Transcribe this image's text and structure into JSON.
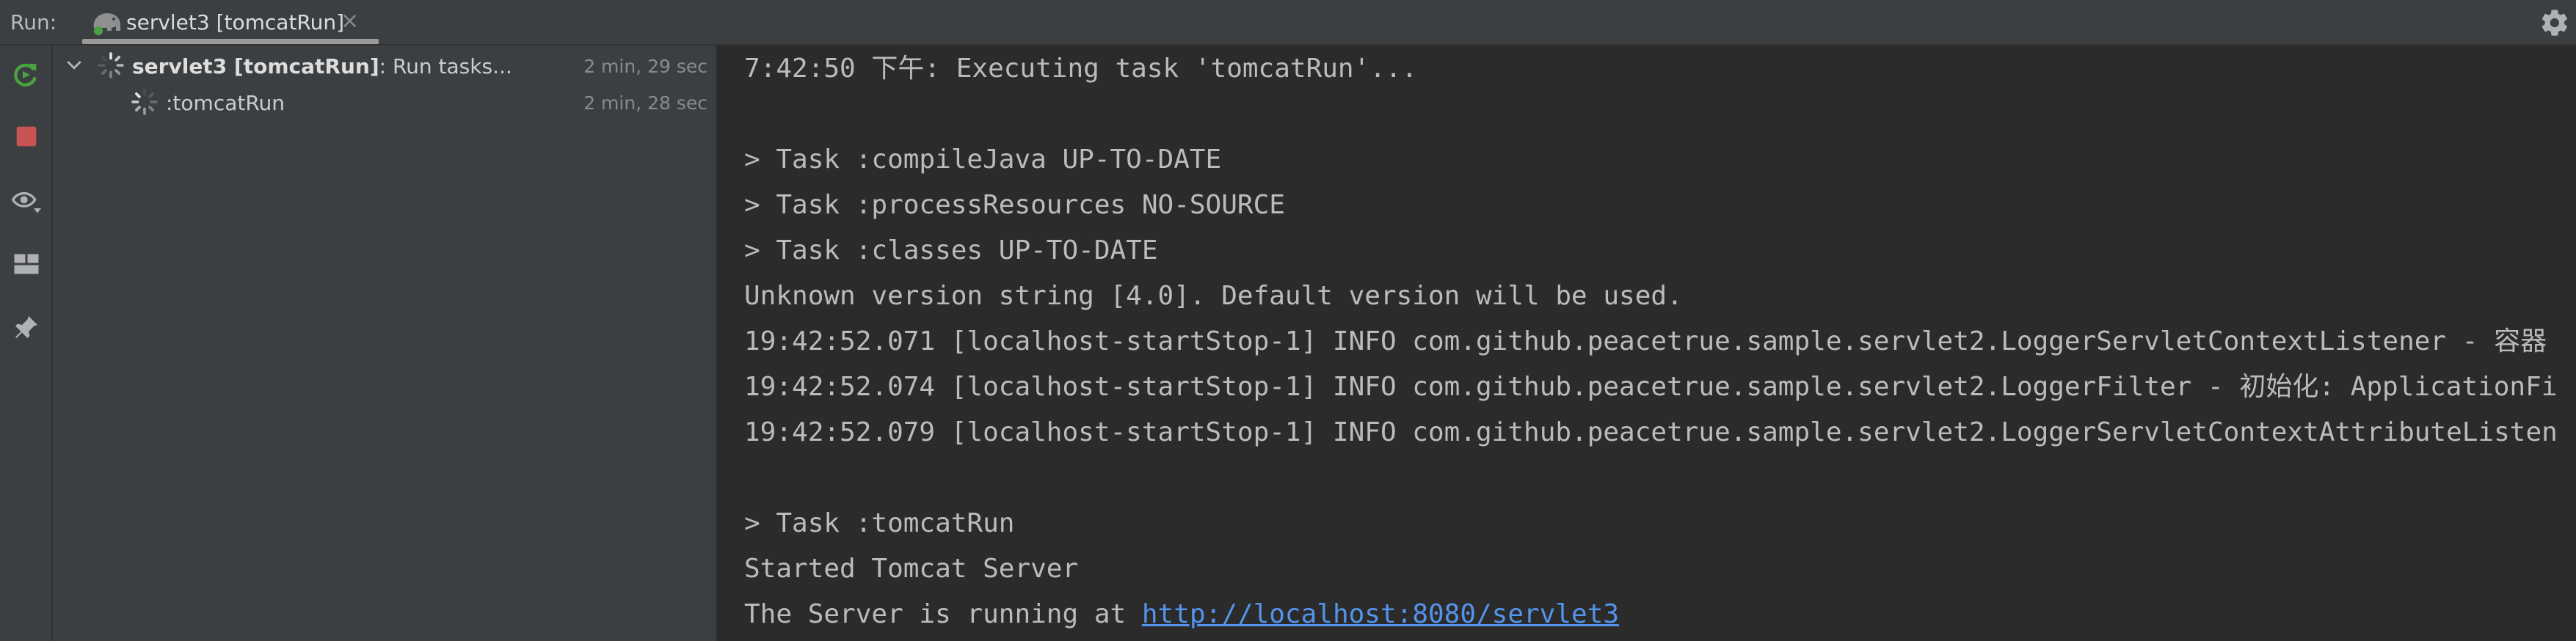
{
  "run_bar": {
    "label": "Run:",
    "tab": {
      "label": "servlet3 [tomcatRun]",
      "close": "×"
    }
  },
  "toolbar": {
    "buttons": [
      "rerun-icon",
      "stop-icon",
      "eye-icon",
      "layout-icon",
      "pin-icon"
    ]
  },
  "tree": {
    "root": {
      "name": "servlet3 [tomcatRun]",
      "status": ": Run tasks...",
      "time": "2 min, 29 sec"
    },
    "child": {
      "name": ":tomcatRun",
      "time": "2 min, 28 sec"
    }
  },
  "console": {
    "lines": [
      "7:42:50 下午: Executing task 'tomcatRun'...",
      "",
      "> Task :compileJava UP-TO-DATE",
      "> Task :processResources NO-SOURCE",
      "> Task :classes UP-TO-DATE",
      "Unknown version string [4.0]. Default version will be used.",
      "19:42:52.071 [localhost-startStop-1] INFO com.github.peacetrue.sample.servlet2.LoggerServletContextListener - 容器",
      "19:42:52.074 [localhost-startStop-1] INFO com.github.peacetrue.sample.servlet2.LoggerFilter - 初始化: ApplicationFi",
      "19:42:52.079 [localhost-startStop-1] INFO com.github.peacetrue.sample.servlet2.LoggerServletContextAttributeListen",
      "",
      "> Task :tomcatRun",
      "Started Tomcat Server"
    ],
    "last_line_prefix": "The Server is running at ",
    "last_line_link": "http://localhost:8080/servlet3"
  },
  "colors": {
    "accent_green": "#4aa33f",
    "stop_red": "#c75450",
    "link_blue": "#5394ec"
  }
}
